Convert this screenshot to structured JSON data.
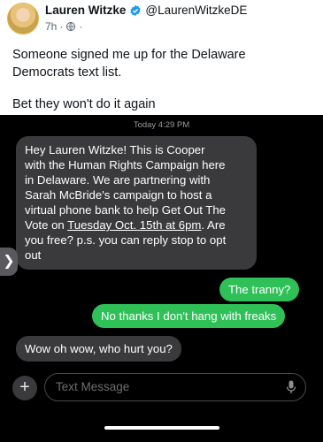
{
  "post": {
    "author_name": "Lauren Witzke",
    "author_handle": "@LaurenWitzkeDE",
    "time": "7h",
    "dot_1": "·",
    "dot_2": "·",
    "text_line_1": "Someone signed me up for the Delaware",
    "text_line_2": "Democrats text list.",
    "text_line_3": "Bet they won't do it again"
  },
  "sms": {
    "timestamp": "Today 4:29 PM",
    "incoming_lines": [
      "Hey Lauren Witzke! This is Cooper",
      "with the Human Rights Campaign here",
      "in Delaware. We are partnering with",
      "Sarah McBride's campaign to host a",
      "virtual phone bank to help Get Out The",
      "Vote on ",
      "Tuesday Oct. 15th at 6pm",
      ". Are",
      "you free? p.s. you can reply stop to opt",
      "out"
    ],
    "reply_1": "The tranny?",
    "reply_2": "No thanks I don't hang with freaks",
    "response": "Wow oh wow, who hurt you?",
    "placeholder": "Text Message",
    "add_symbol": "+",
    "side_handle_symbol": "❯"
  },
  "colors": {
    "outgoing": "#2fc158",
    "incoming": "#3a3a3c",
    "verified": "#1d9bf0"
  },
  "icons": {
    "verified": "verified-badge-icon",
    "audience": "public-globe-icon",
    "mic": "microphone-icon"
  }
}
